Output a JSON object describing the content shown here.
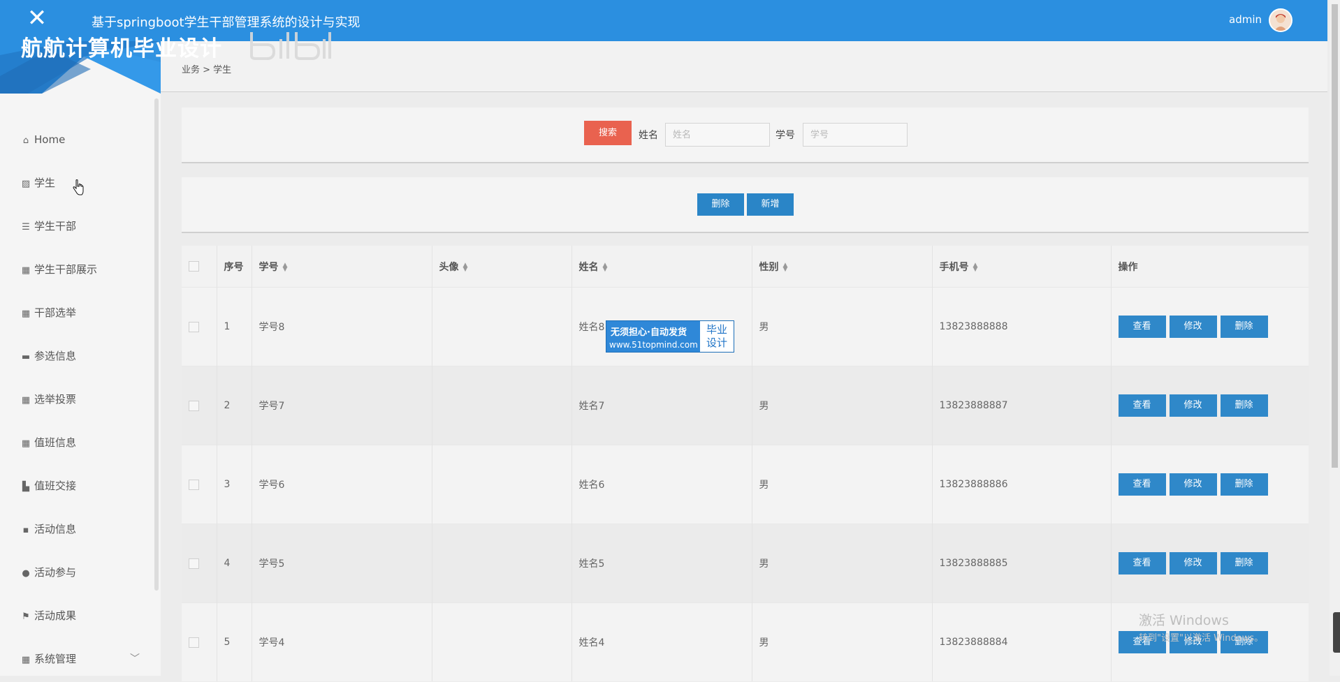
{
  "header": {
    "title": "基于springboot学生干部管理系统的设计与实现",
    "user": "admin"
  },
  "watermark": {
    "text": "航航计算机毕业设计",
    "bili": "bilibili"
  },
  "sidebar": {
    "items": [
      {
        "label": "Home",
        "icon": "home-icon"
      },
      {
        "label": "学生",
        "icon": "chart-icon"
      },
      {
        "label": "学生干部",
        "icon": "list-icon"
      },
      {
        "label": "学生干部展示",
        "icon": "grid-icon"
      },
      {
        "label": "干部选举",
        "icon": "grid-icon"
      },
      {
        "label": "参选信息",
        "icon": "monitor-icon"
      },
      {
        "label": "选举投票",
        "icon": "grid-icon"
      },
      {
        "label": "值班信息",
        "icon": "grid-icon"
      },
      {
        "label": "值班交接",
        "icon": "stamp-icon"
      },
      {
        "label": "活动信息",
        "icon": "comment-icon"
      },
      {
        "label": "活动参与",
        "icon": "pin-icon"
      },
      {
        "label": "活动成果",
        "icon": "flag-icon"
      },
      {
        "label": "系统管理",
        "icon": "grid-icon"
      }
    ]
  },
  "breadcrumb": "业务 > 学生",
  "search": {
    "button": "搜索",
    "name_label": "姓名",
    "name_placeholder": "姓名",
    "id_label": "学号",
    "id_placeholder": "学号"
  },
  "actions": {
    "delete": "删除",
    "add": "新增"
  },
  "table": {
    "headers": [
      "序号",
      "学号",
      "头像",
      "姓名",
      "性别",
      "手机号",
      "操作"
    ],
    "rows": [
      {
        "no": "1",
        "sid": "学号8",
        "name": "姓名8",
        "gender": "男",
        "phone": "13823888888"
      },
      {
        "no": "2",
        "sid": "学号7",
        "name": "姓名7",
        "gender": "男",
        "phone": "13823888887"
      },
      {
        "no": "3",
        "sid": "学号6",
        "name": "姓名6",
        "gender": "男",
        "phone": "13823888886"
      },
      {
        "no": "4",
        "sid": "学号5",
        "name": "姓名5",
        "gender": "男",
        "phone": "13823888885"
      },
      {
        "no": "5",
        "sid": "学号4",
        "name": "姓名4",
        "gender": "男",
        "phone": "13823888884"
      }
    ],
    "row_actions": {
      "view": "查看",
      "edit": "修改",
      "delete": "删除"
    }
  },
  "promo": {
    "line1": "无须担心·自动发货",
    "line2": "www.51topmind.com",
    "badge1": "毕业",
    "badge2": "设计"
  },
  "os_notice": {
    "title": "激活 Windows",
    "sub": "转到\"设置\"以激活 Windows。"
  },
  "colors": {
    "topbar": "#2b8fe0",
    "search_button": "#e9624f",
    "primary_button": "#2a85c7"
  }
}
